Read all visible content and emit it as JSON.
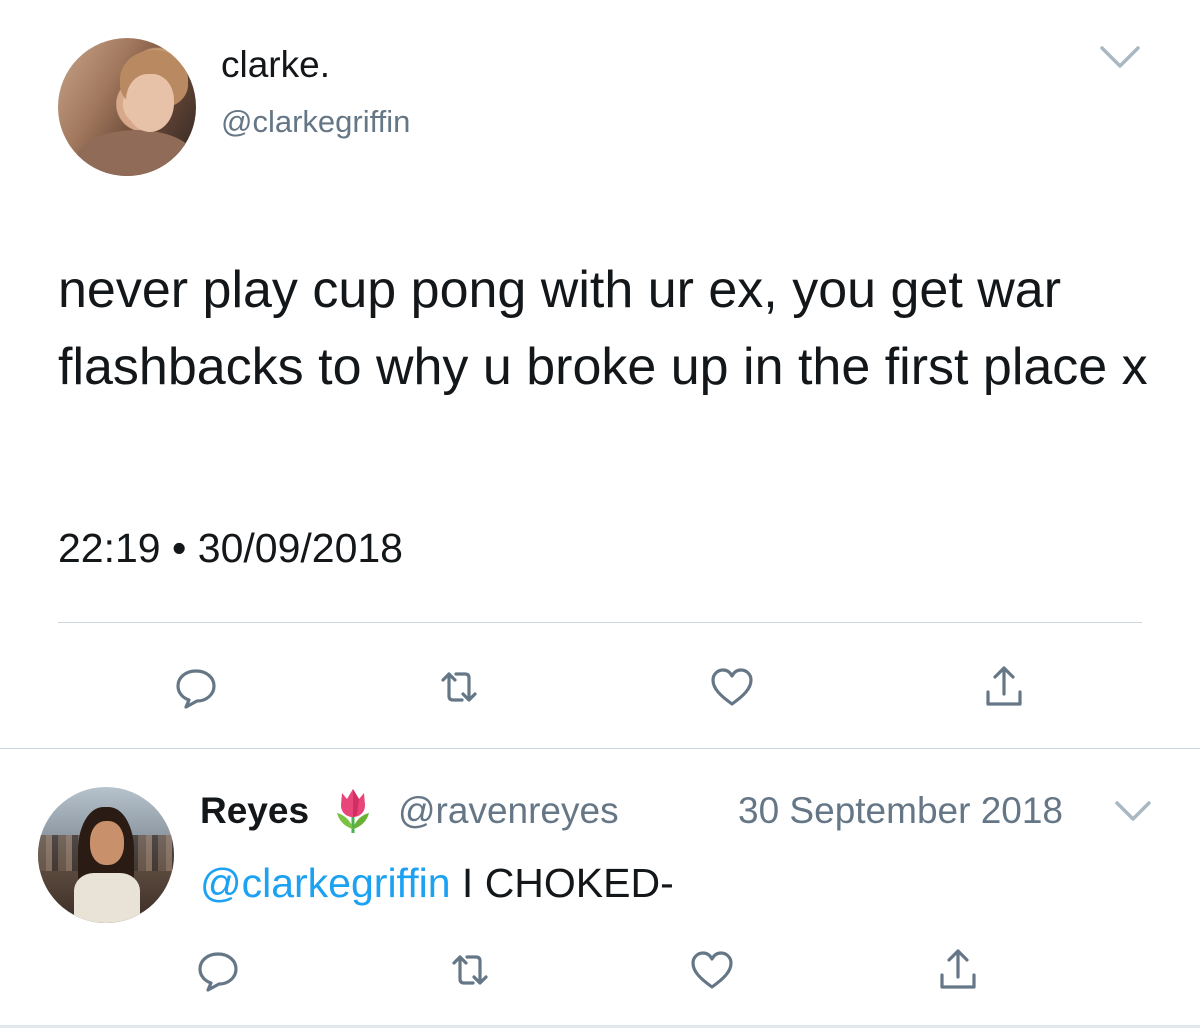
{
  "tweet": {
    "display_name": "clarke.",
    "handle": "@clarkegriffin",
    "text": "never play cup pong with ur ex, you get war flashbacks to why u broke up in the first place x",
    "time": "22:19",
    "separator": "•",
    "date": "30/09/2018",
    "actions": [
      "reply-icon",
      "retweet-icon",
      "like-icon",
      "share-icon"
    ]
  },
  "reply": {
    "display_name": "Reyes",
    "name_emoji": "tulip-icon",
    "handle": "@ravenreyes",
    "date": "30 September 2018",
    "mention": "@clarkegriffin",
    "text": " I CHOKED-",
    "actions": [
      "reply-icon",
      "retweet-icon",
      "like-icon",
      "share-icon"
    ]
  },
  "colors": {
    "text": "#14171a",
    "secondary": "#657786",
    "link": "#1da1f2",
    "divider": "#ccd6dd"
  }
}
